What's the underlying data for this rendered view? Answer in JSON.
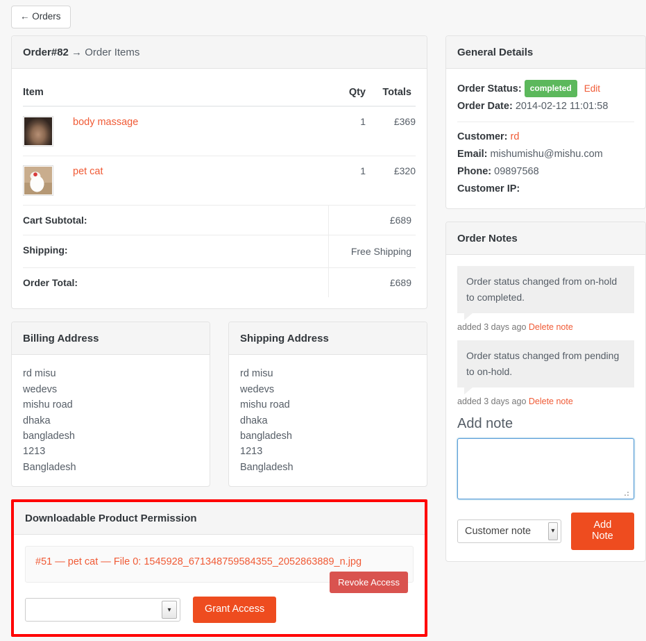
{
  "back_button": {
    "label": "← Orders"
  },
  "order_items_panel": {
    "title_bold": "Order#82",
    "title_rest": " → Order Items",
    "columns": {
      "item": "Item",
      "qty": "Qty",
      "totals": "Totals"
    },
    "rows": [
      {
        "name": "body massage",
        "qty": "1",
        "total": "£369",
        "thumb": "product-thumbnail-body-massage"
      },
      {
        "name": "pet cat",
        "qty": "1",
        "total": "£320",
        "thumb": "product-thumbnail-pet-cat"
      }
    ],
    "totals": [
      {
        "label": "Cart Subtotal:",
        "value": "£689"
      },
      {
        "label": "Shipping:",
        "value": "Free Shipping"
      },
      {
        "label": "Order Total:",
        "value": "£689"
      }
    ]
  },
  "billing_address": {
    "title": "Billing Address",
    "lines": [
      "rd misu",
      "wedevs",
      "mishu road",
      "dhaka",
      "bangladesh",
      "1213",
      "Bangladesh"
    ]
  },
  "shipping_address": {
    "title": "Shipping Address",
    "lines": [
      "rd misu",
      "wedevs",
      "mishu road",
      "dhaka",
      "bangladesh",
      "1213",
      "Bangladesh"
    ]
  },
  "downloadable": {
    "title": "Downloadable Product Permission",
    "highlight_color": "#ff0000",
    "permission_text": "#51 — pet cat — File 0: 1545928_671348759584355_2052863889_n.jpg",
    "revoke_label": "Revoke Access",
    "select_value": "",
    "grant_label": "Grant Access"
  },
  "general_details": {
    "title": "General Details",
    "status_label": "Order Status:",
    "status_value": "completed",
    "status_color": "#5cb85c",
    "edit_label": "Edit",
    "date_label": "Order Date:",
    "date_value": "2014-02-12 11:01:58",
    "customer_label": "Customer:",
    "customer_value": "rd",
    "email_label": "Email:",
    "email_value": "mishumishu@mishu.com",
    "phone_label": "Phone:",
    "phone_value": "09897568",
    "ip_label": "Customer IP:",
    "ip_value": ""
  },
  "order_notes": {
    "title": "Order Notes",
    "notes": [
      {
        "text": "Order status changed from on-hold to completed.",
        "added": "added 3 days ago",
        "delete_label": "Delete note"
      },
      {
        "text": "Order status changed from pending to on-hold.",
        "added": "added 3 days ago",
        "delete_label": "Delete note"
      }
    ],
    "add_note_title": "Add note",
    "textarea_value": "",
    "note_type_value": "Customer note",
    "add_note_label": "Add Note"
  }
}
